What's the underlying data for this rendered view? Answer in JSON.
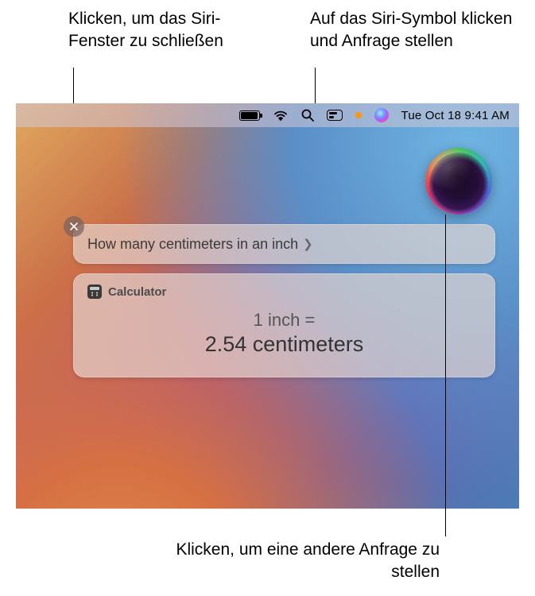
{
  "annotations": {
    "close_siri": "Klicken, um das Siri-Fenster zu schließen",
    "siri_icon": "Auf das Siri-Symbol klicken und Anfrage stellen",
    "ask_again": "Klicken, um eine andere Anfrage zu stellen"
  },
  "menubar": {
    "datetime": "Tue Oct 18  9:41 AM"
  },
  "siri": {
    "query": "How many centimeters in an inch",
    "result": {
      "app": "Calculator",
      "line1": "1 inch =",
      "line2": "2.54 centimeters"
    }
  }
}
